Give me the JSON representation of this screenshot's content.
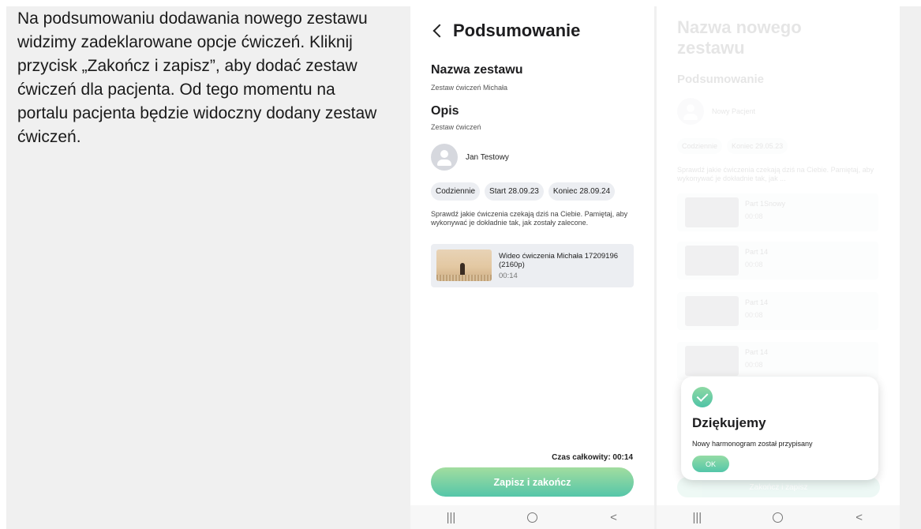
{
  "intro_text": "Na podsumowaniu dodawania nowego zestawu widzimy zadeklarowane opcje ćwiczeń. Kliknij przycisk „Zakończ i zapisz”, aby dodać zestaw ćwiczeń dla pacjenta. Od tego momentu na portalu pacjenta będzie widoczny dodany zestaw ćwiczeń.",
  "summary": {
    "back_icon": "chevron-left-icon",
    "title": "Podsumowanie",
    "set_name_heading": "Nazwa zestawu",
    "set_name_value": "Zestaw ćwiczeń Michała",
    "description_heading": "Opis",
    "description_value": "Zestaw ćwiczeń",
    "patient_name": "Jan Testowy",
    "chips": [
      "Codziennie",
      "Start 28.09.23",
      "Koniec 28.09.24"
    ],
    "instructions": "Sprawdź jakie ćwiczenia czekają dziś na Ciebie. Pamiętaj, aby wykonywać je dokładnie tak, jak zostały zalecone.",
    "video": {
      "title": "Wideo ćwiczenia Michała 17209196 (2160p)",
      "duration": "00:14"
    },
    "total_time": "Czas całkowity: 00:14",
    "save_button": "Zapisz i zakończ"
  },
  "navbar": {
    "recents": "|||",
    "back": "<"
  },
  "confirmation": {
    "title": "Nazwa nowego zestawu",
    "subtitle": "Podsumowanie",
    "patient_name": "Nowy Pacjent",
    "chips": [
      "Codziennie",
      "Koniec 29.05.23"
    ],
    "instructions": "Sprawdź jakie ćwiczenia czekają dziś na Ciebie. Pamiętaj, aby wykonywać je dokładnie tak, jak ...",
    "items": [
      {
        "name": "Part 1Snowy",
        "duration": "00:08"
      },
      {
        "name": "Part 14",
        "duration": "00:08"
      },
      {
        "name": "Part 14",
        "duration": "00:08"
      },
      {
        "name": "Part 14",
        "duration": "00:08"
      }
    ],
    "button": "Zakończ i zapisz",
    "dialog": {
      "title": "Dziękujemy",
      "message": "Nowy harmonogram został przypisany",
      "ok": "OK"
    }
  },
  "colors": {
    "accent_start": "#a2dd9f",
    "accent_end": "#55c6a9",
    "chip_bg": "#eceef2",
    "strip_bg": "#f0f0f0"
  }
}
